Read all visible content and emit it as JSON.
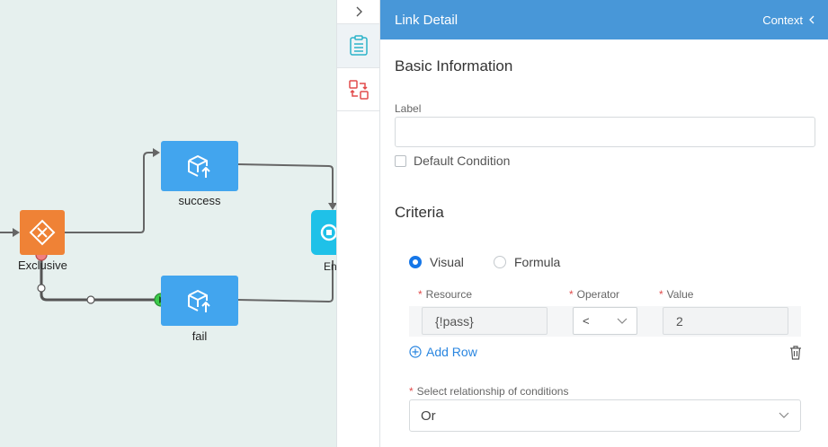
{
  "canvas": {
    "nodes": {
      "success_label": "success",
      "fail_label": "fail",
      "gateway_label": "Exclusive",
      "end_label": "En"
    }
  },
  "toolbar": {
    "collapse_icon": "chevron-right-icon",
    "properties_icon": "clipboard-list-icon",
    "swap_icon": "swap-icon"
  },
  "panel": {
    "title": "Link Detail",
    "context_label": "Context",
    "basic": {
      "heading": "Basic Information",
      "label_field_label": "Label",
      "label_value": "",
      "default_condition_label": "Default Condition"
    },
    "criteria": {
      "heading": "Criteria",
      "mode_visual": "Visual",
      "mode_formula": "Formula",
      "selected_mode": "Visual",
      "col_resource": "Resource",
      "col_operator": "Operator",
      "col_value": "Value",
      "required_marker": "*",
      "row": {
        "resource": "{!pass}",
        "operator": "<",
        "value": "2"
      },
      "add_row_label": "Add Row",
      "relationship_label": "Select relationship of conditions",
      "relationship_value": "Or"
    },
    "colors": {
      "header": "#4897d8",
      "accent": "#1677e8",
      "task": "#42a5ee",
      "gateway": "#ef8236",
      "end": "#1fc1e8"
    }
  }
}
